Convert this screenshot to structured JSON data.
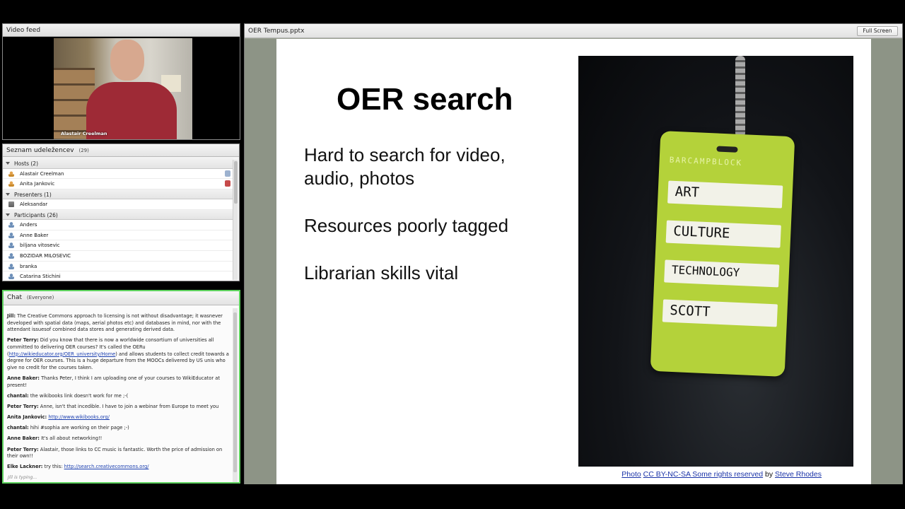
{
  "video": {
    "title": "Video feed",
    "speaker_name": "Alastair Creelman"
  },
  "attendees": {
    "title": "Seznam udeležencev",
    "count": "(29)",
    "groups": {
      "hosts": "Hosts (2)",
      "presenters": "Presenters (1)",
      "participants": "Participants (26)"
    },
    "hosts": [
      "Alastair Creelman",
      "Anita Jankovic"
    ],
    "presenters": [
      "Aleksandar"
    ],
    "participants": [
      "Anders",
      "Anne Baker",
      "biljana vitosevic",
      "BOZIDAR MILOSEVIC",
      "branka",
      "Catarina Stichini"
    ]
  },
  "chat": {
    "title": "Chat",
    "scope": "(Everyone)",
    "messages": [
      {
        "who": "Jill:",
        "text": " The Creative Commons approach to licensing is not without disadvantage; it wasnever developed with spatial data (maps, aerial photos etc) and databases in mind, nor with the attendant issuesof combined data stores and generating derived data.",
        "link": "",
        "after": ""
      },
      {
        "who": "Peter Terry:",
        "text": " Did you know that there is now a worldwide consortium of universities all committed to delivering OER courses? It's called the OERu (",
        "link": "http://wikieducator.org/OER_university/Home",
        "after": ") and allows students to collect credit towards a degree for OER courses. This is a huge departure from the MOOCs delivered by US unis who give no credit for the courses taken."
      },
      {
        "who": "Anne Baker:",
        "text": " Thanks Peter, I think I am uploading one of your courses to WikiEducator at present!",
        "link": "",
        "after": ""
      },
      {
        "who": "chantal:",
        "text": " the wikibooks link doesn't work for me ;-(",
        "link": "",
        "after": ""
      },
      {
        "who": "Peter Terry:",
        "text": " Anne, isn't that incedible. I have to join a webinar from Europe to meet you",
        "link": "",
        "after": ""
      },
      {
        "who": "Anita Jankovic:",
        "text": " ",
        "link": "http://www.wikibooks.org/",
        "after": ""
      },
      {
        "who": "chantal:",
        "text": " hihi #sophia are working on their page ;-)",
        "link": "",
        "after": ""
      },
      {
        "who": "Anne Baker:",
        "text": " It's all about networking!!",
        "link": "",
        "after": ""
      },
      {
        "who": "Peter Terry:",
        "text": " Alastair, those links to CC music is fantastic. Worth the price of admission on their own!!",
        "link": "",
        "after": ""
      },
      {
        "who": "Elke Lackner:",
        "text": " try this: ",
        "link": "http://search.creativecommons.org/",
        "after": ""
      }
    ],
    "typing": "Jill is typing..."
  },
  "share": {
    "title": "OER Tempus.pptx",
    "fullscreen_label": "Full Screen"
  },
  "slide": {
    "title": "OER search",
    "bullets": [
      "Hard to search for video,",
      "audio, photos",
      "Resources poorly tagged",
      "Librarian skills vital"
    ],
    "badge": {
      "brand": "BARCAMPBLOCK",
      "lines": [
        "ART",
        "CULTURE",
        "TECHNOLOGY",
        "SCOTT"
      ]
    },
    "credit": {
      "photo": "Photo",
      "license": "CC BY-NC-SA Some rights reserved",
      "by": " by ",
      "author": "Steve Rhodes"
    }
  },
  "colors": {
    "chat_border": "#5fd35f",
    "badge": "#b4d23a",
    "link": "#1b3fb0"
  }
}
